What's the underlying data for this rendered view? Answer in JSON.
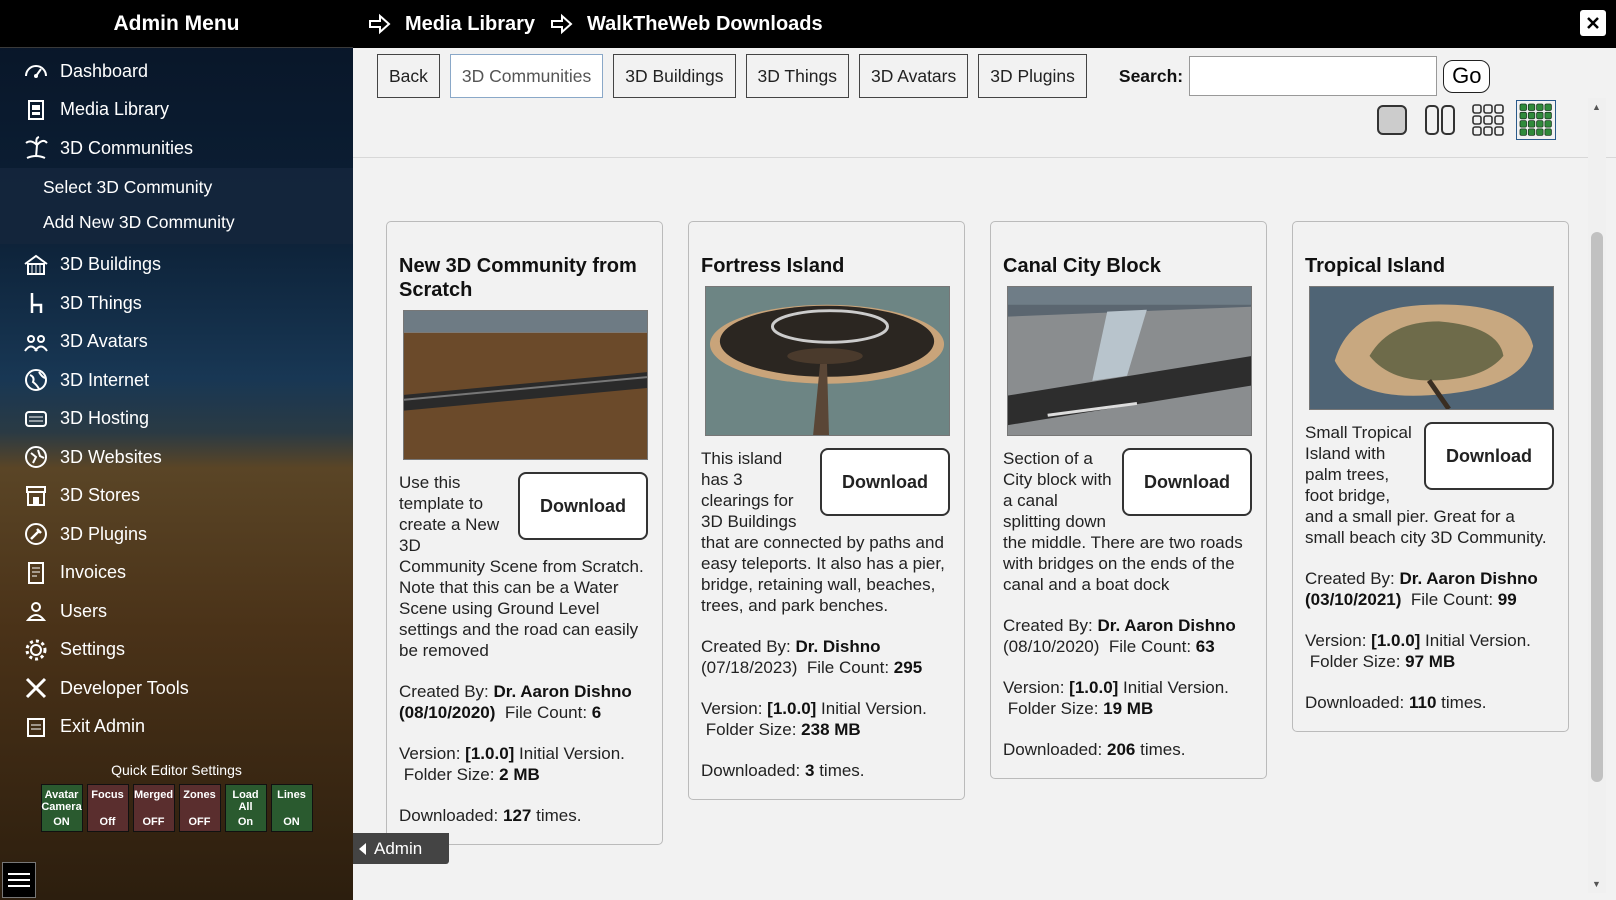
{
  "sidebar": {
    "title": "Admin Menu",
    "items_top": [
      {
        "label": "Dashboard",
        "icon": "dashboard-icon"
      },
      {
        "label": "Media Library",
        "icon": "media-library-icon"
      },
      {
        "label": "3D Communities",
        "icon": "palm-tree-icon"
      }
    ],
    "subitems": [
      {
        "label": "Select 3D Community"
      },
      {
        "label": "Add New 3D Community"
      }
    ],
    "items_bottom": [
      {
        "label": "3D Buildings",
        "icon": "building-icon"
      },
      {
        "label": "3D Things",
        "icon": "chair-icon"
      },
      {
        "label": "3D Avatars",
        "icon": "avatars-icon"
      },
      {
        "label": "3D Internet",
        "icon": "globe-icon"
      },
      {
        "label": "3D Hosting",
        "icon": "hosting-icon"
      },
      {
        "label": "3D Websites",
        "icon": "websites-icon"
      },
      {
        "label": "3D Stores",
        "icon": "store-icon"
      },
      {
        "label": "3D Plugins",
        "icon": "plugin-icon"
      },
      {
        "label": "Invoices",
        "icon": "invoice-icon"
      },
      {
        "label": "Users",
        "icon": "user-icon"
      },
      {
        "label": "Settings",
        "icon": "gear-icon"
      },
      {
        "label": "Developer Tools",
        "icon": "tools-icon"
      },
      {
        "label": "Exit Admin",
        "icon": "exit-icon"
      }
    ],
    "quick": {
      "title": "Quick Editor Settings",
      "buttons": [
        {
          "label": "Avatar Camera",
          "state": "ON"
        },
        {
          "label": "Focus",
          "state": "Off"
        },
        {
          "label": "Merged",
          "state": "OFF"
        },
        {
          "label": "Zones",
          "state": "OFF"
        },
        {
          "label": "Load All",
          "state": "On"
        },
        {
          "label": "Lines",
          "state": "ON"
        }
      ]
    }
  },
  "topbar": {
    "crumb1": "Media Library",
    "crumb2": "WalkTheWeb Downloads"
  },
  "toolbar": {
    "tabs": [
      "Back",
      "3D Communities",
      "3D Buildings",
      "3D Things",
      "3D Avatars",
      "3D Plugins"
    ],
    "active_tab": "3D Communities",
    "search_label": "Search:",
    "search_value": "",
    "go_label": "Go"
  },
  "cards": [
    {
      "title": "New 3D Community from Scratch",
      "description": "Use this template to create a New 3D Community Scene from Scratch. Note that this can be a Water Scene using Ground Level settings and the road can easily be removed",
      "download_label": "Download",
      "created_label": "Created By:",
      "author": "Dr. Aaron Dishno",
      "date": "(08/10/2020)",
      "file_count_label": "File Count:",
      "file_count": "6",
      "version_label": "Version:",
      "version": "[1.0.0]",
      "version_note": "Initial Version.",
      "folder_size_label": "Folder Size:",
      "folder_size": "2 MB",
      "downloaded_label": "Downloaded:",
      "downloaded": "127",
      "times_label": "times."
    },
    {
      "title": "Fortress Island",
      "description": "This island has 3 clearings for 3D Buildings that are connected by paths and easy teleports. It also has a pier, bridge, retaining wall, beaches, trees, and park benches.",
      "download_label": "Download",
      "created_label": "Created By:",
      "author": "Dr. Dishno",
      "date": "(07/18/2023)",
      "file_count_label": "File Count:",
      "file_count": "295",
      "version_label": "Version:",
      "version": "[1.0.0]",
      "version_note": "Initial Version.",
      "folder_size_label": "Folder Size:",
      "folder_size": "238 MB",
      "downloaded_label": "Downloaded:",
      "downloaded": "3",
      "times_label": "times."
    },
    {
      "title": "Canal City Block",
      "description": "Section of a City block with a canal splitting down the middle. There are two roads with bridges on the ends of the canal and a boat dock",
      "download_label": "Download",
      "created_label": "Created By:",
      "author": "Dr. Aaron Dishno",
      "date": "(08/10/2020)",
      "file_count_label": "File Count:",
      "file_count": "63",
      "version_label": "Version:",
      "version": "[1.0.0]",
      "version_note": "Initial Version.",
      "folder_size_label": "Folder Size:",
      "folder_size": "19 MB",
      "downloaded_label": "Downloaded:",
      "downloaded": "206",
      "times_label": "times."
    },
    {
      "title": "Tropical Island",
      "description": "Small Tropical Island with palm trees, foot bridge, and a small pier. Great for a small beach city 3D Community.",
      "download_label": "Download",
      "created_label": "Created By:",
      "author": "Dr. Aaron Dishno",
      "date": "(03/10/2021)",
      "file_count_label": "File Count:",
      "file_count": "99",
      "version_label": "Version:",
      "version": "[1.0.0]",
      "version_note": "Initial Version.",
      "folder_size_label": "Folder Size:",
      "folder_size": "97 MB",
      "downloaded_label": "Downloaded:",
      "downloaded": "110",
      "times_label": "times."
    }
  ],
  "admin_tab": "Admin",
  "colors": {
    "accent_green": "#2a5a2f",
    "accent_red": "#5a2e2e",
    "active_tab_border": "#8aa8c8"
  }
}
